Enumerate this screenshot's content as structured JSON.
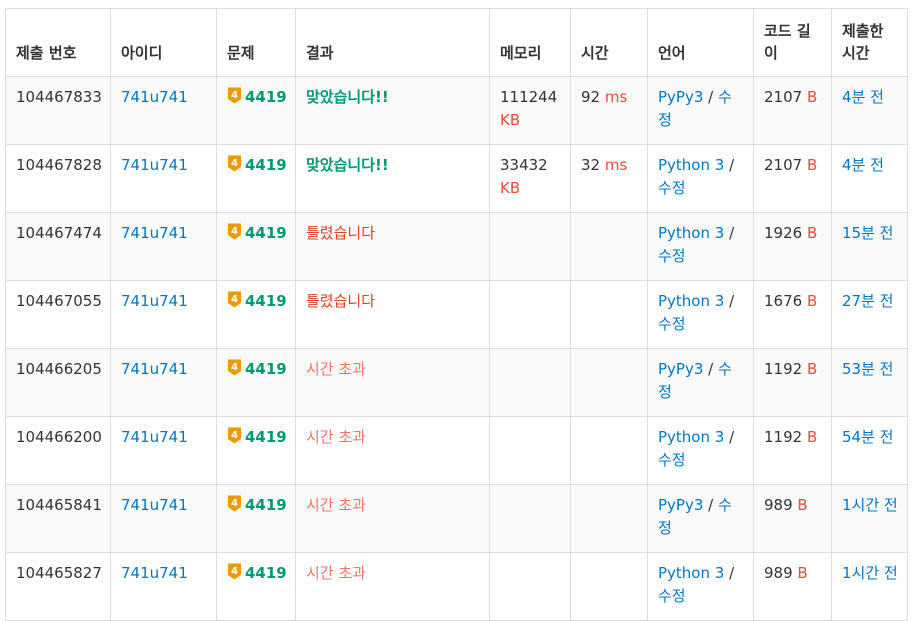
{
  "headers": [
    "제출 번호",
    "아이디",
    "문제",
    "결과",
    "메모리",
    "시간",
    "언어",
    "코드 길이",
    "제출한 시간"
  ],
  "tier_icon_label": "4",
  "colors": {
    "link": "#0076c0",
    "accepted": "#009874",
    "wrong": "#dd4124",
    "timeout": "#fa7268",
    "unit": "#e74c3c",
    "tier_gold": "#ec9a00"
  },
  "rows": [
    {
      "id": "104467833",
      "user": "741u741",
      "problem": "4419",
      "result": "맞았습니다!!",
      "result_type": "ac",
      "memory": "111244",
      "memory_unit": "KB",
      "time": "92",
      "time_unit": "ms",
      "lang": "PyPy3",
      "edit": "수정",
      "code_len": "2107",
      "code_unit": "B",
      "submitted": "4분 전"
    },
    {
      "id": "104467828",
      "user": "741u741",
      "problem": "4419",
      "result": "맞았습니다!!",
      "result_type": "ac",
      "memory": "33432",
      "memory_unit": "KB",
      "time": "32",
      "time_unit": "ms",
      "lang": "Python 3",
      "edit": "수정",
      "code_len": "2107",
      "code_unit": "B",
      "submitted": "4분 전"
    },
    {
      "id": "104467474",
      "user": "741u741",
      "problem": "4419",
      "result": "틀렸습니다",
      "result_type": "wa",
      "memory": "",
      "memory_unit": "",
      "time": "",
      "time_unit": "",
      "lang": "Python 3",
      "edit": "수정",
      "code_len": "1926",
      "code_unit": "B",
      "submitted": "15분 전"
    },
    {
      "id": "104467055",
      "user": "741u741",
      "problem": "4419",
      "result": "틀렸습니다",
      "result_type": "wa",
      "memory": "",
      "memory_unit": "",
      "time": "",
      "time_unit": "",
      "lang": "Python 3",
      "edit": "수정",
      "code_len": "1676",
      "code_unit": "B",
      "submitted": "27분 전"
    },
    {
      "id": "104466205",
      "user": "741u741",
      "problem": "4419",
      "result": "시간 초과",
      "result_type": "tle",
      "memory": "",
      "memory_unit": "",
      "time": "",
      "time_unit": "",
      "lang": "PyPy3",
      "edit": "수정",
      "code_len": "1192",
      "code_unit": "B",
      "submitted": "53분 전"
    },
    {
      "id": "104466200",
      "user": "741u741",
      "problem": "4419",
      "result": "시간 초과",
      "result_type": "tle",
      "memory": "",
      "memory_unit": "",
      "time": "",
      "time_unit": "",
      "lang": "Python 3",
      "edit": "수정",
      "code_len": "1192",
      "code_unit": "B",
      "submitted": "54분 전"
    },
    {
      "id": "104465841",
      "user": "741u741",
      "problem": "4419",
      "result": "시간 초과",
      "result_type": "tle",
      "memory": "",
      "memory_unit": "",
      "time": "",
      "time_unit": "",
      "lang": "PyPy3",
      "edit": "수정",
      "code_len": "989",
      "code_unit": "B",
      "submitted": "1시간 전"
    },
    {
      "id": "104465827",
      "user": "741u741",
      "problem": "4419",
      "result": "시간 초과",
      "result_type": "tle",
      "memory": "",
      "memory_unit": "",
      "time": "",
      "time_unit": "",
      "lang": "Python 3",
      "edit": "수정",
      "code_len": "989",
      "code_unit": "B",
      "submitted": "1시간 전"
    }
  ]
}
